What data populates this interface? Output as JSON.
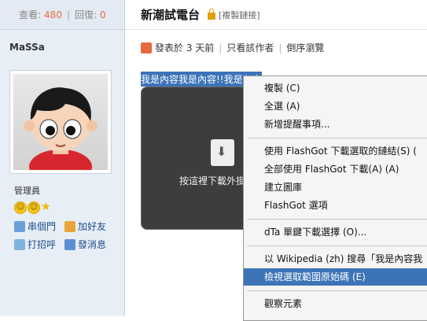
{
  "sidebar": {
    "views_label": "查看:",
    "views_count": "480",
    "replies_label": "回復:",
    "replies_count": "0",
    "username": "MaSSa",
    "role": "管理員",
    "actions": [
      {
        "label": "串個門",
        "icon": "house-icon"
      },
      {
        "label": "加好友",
        "icon": "add-friend-icon"
      },
      {
        "label": "打招呼",
        "icon": "greet-icon"
      },
      {
        "label": "發消息",
        "icon": "message-icon"
      }
    ]
  },
  "thread": {
    "title": "新潮試電台",
    "copy_link": "[複製鏈接]",
    "posted": "發表於 3 天前",
    "author_only": "只看該作者",
    "reverse_view": "倒序瀏覽",
    "selected_text": "我是內容我是內容!!我是內容",
    "flash_text": "按這裡下載外掛"
  },
  "context_menu": {
    "items": [
      "複製 (C)",
      "全選 (A)",
      "新增提醒事項...",
      "使用 FlashGot 下載選取的鏈結(S) (",
      "全部使用 FlashGot 下載(A) (A)",
      "建立圖庫",
      "FlashGot 選項",
      "dTa 單鍵下載選擇 (O)...",
      "以 Wikipedia (zh) 搜尋「我是內容我",
      "檢視選取範圍原始碼 (E)",
      "觀察元素"
    ],
    "highlighted_index": 9
  },
  "colors": {
    "accent": "#e8683f",
    "highlight": "#3d74b8",
    "link": "#1b4d8a"
  }
}
